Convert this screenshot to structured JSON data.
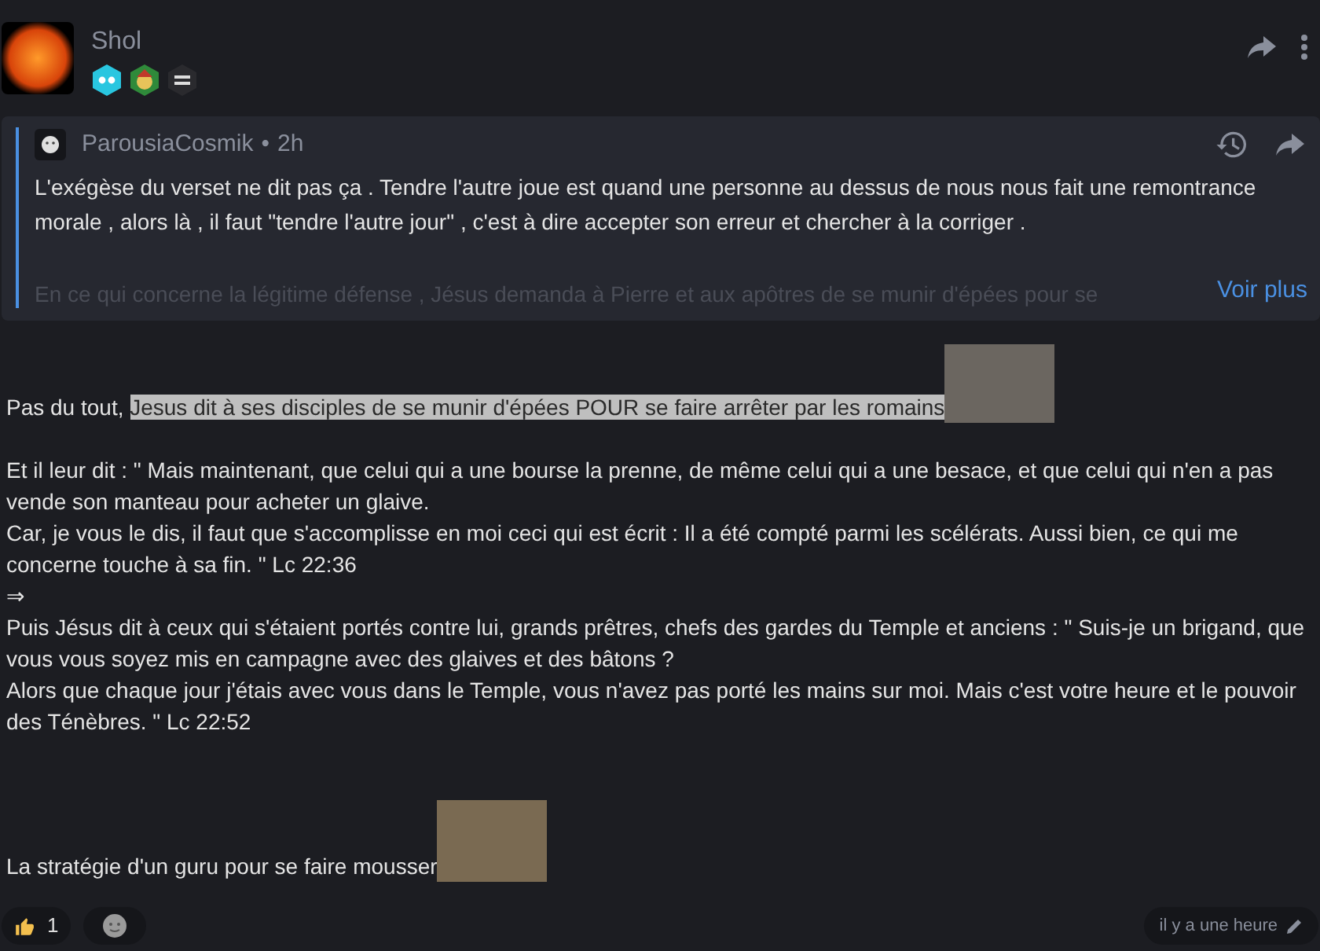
{
  "post": {
    "author": "Shol",
    "badges": [
      {
        "kind": "stars"
      },
      {
        "kind": "elf"
      },
      {
        "kind": "dark"
      }
    ]
  },
  "quote": {
    "author": "ParousiaCosmik",
    "separator": "•",
    "time": "2h",
    "paragraph": "L'exégèse du verset ne dit pas ça . Tendre l'autre joue est quand une personne au dessus de nous nous fait une remontrance morale , alors là , il faut \"tendre l'autre jour\" , c'est à dire accepter son erreur et chercher à la corriger .",
    "faded": "En ce qui concerne la légitime défense , Jésus demanda à Pierre et aux apôtres de se munir d'épées pour se",
    "more": "Voir plus"
  },
  "body": [
    {
      "kind": "highlight",
      "text": "Pas du tout, ",
      "highlight": "Jesus dit à ses disciples de se munir d'épées POUR se faire arrêter par les romains"
    },
    {
      "kind": "gap"
    },
    {
      "kind": "line",
      "text": "Et il leur dit : \" Mais maintenant, que celui qui a une bourse la prenne, de même celui qui a une besace, et que celui qui n'en a pas vende son manteau pour acheter un glaive."
    },
    {
      "kind": "line",
      "text": "Car, je vous le dis, il faut que s'accomplisse en moi ceci qui est écrit : Il a été compté parmi les scélérats. Aussi bien, ce qui me concerne touche à sa fin. \" Lc 22:36"
    },
    {
      "kind": "line",
      "text": "⇒"
    },
    {
      "kind": "line",
      "text": "Puis Jésus dit à ceux qui s'étaient portés contre lui, grands prêtres, chefs des gardes du Temple et anciens : \" Suis-je un brigand, que vous vous soyez mis en campagne avec des glaives et des bâtons ?"
    },
    {
      "kind": "line",
      "text": "Alors que chaque jour j'étais avec vous dans le Temple, vous n'avez pas porté les mains sur moi. Mais c'est votre heure et le pouvoir des Ténèbres. \" Lc 22:52"
    },
    {
      "kind": "gap"
    },
    {
      "kind": "gap"
    },
    {
      "kind": "image_line",
      "text": "La stratégie d'un guru pour se faire mousser"
    }
  ],
  "reactions": [
    {
      "kind": "thumbs",
      "count": "1"
    },
    {
      "kind": "add"
    }
  ],
  "timestamp": "il y a une heure"
}
